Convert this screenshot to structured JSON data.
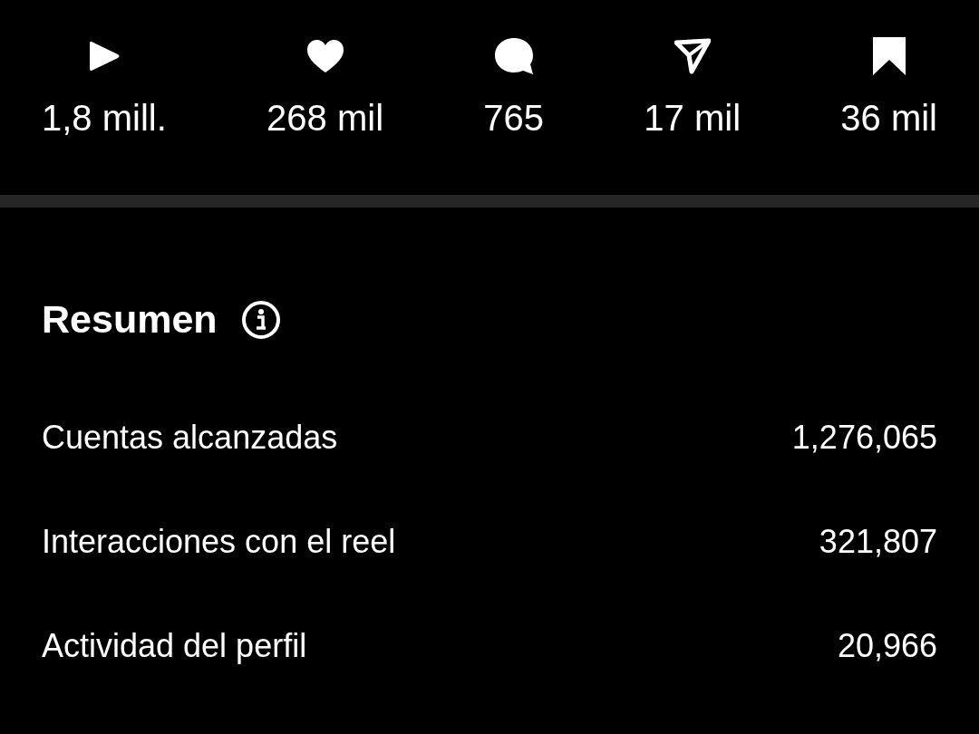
{
  "stats": [
    {
      "kind": "plays",
      "value": "1,8 mill."
    },
    {
      "kind": "likes",
      "value": "268 mil"
    },
    {
      "kind": "comments",
      "value": "765"
    },
    {
      "kind": "shares",
      "value": "17 mil"
    },
    {
      "kind": "saves",
      "value": "36 mil"
    }
  ],
  "summary": {
    "title": "Resumen",
    "rows": [
      {
        "label": "Cuentas alcanzadas",
        "value": "1,276,065"
      },
      {
        "label": "Interacciones con el reel",
        "value": "321,807"
      },
      {
        "label": "Actividad del perfil",
        "value": "20,966"
      }
    ]
  }
}
